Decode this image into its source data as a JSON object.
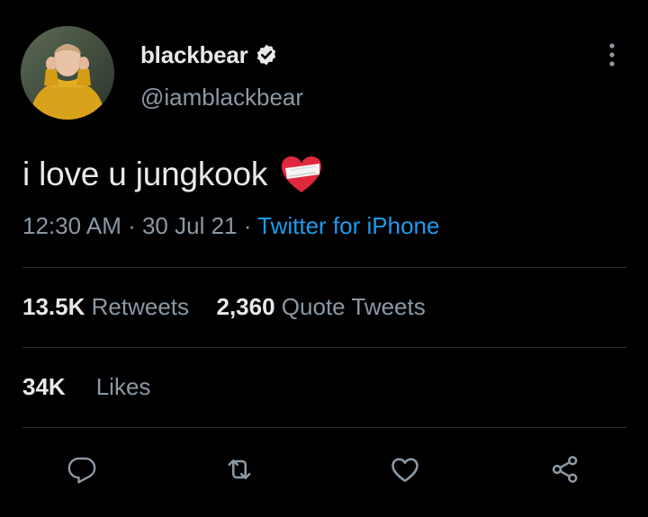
{
  "author": {
    "display_name": "blackbear",
    "handle": "@iamblackbear",
    "verified_icon": "verified-badge-icon",
    "avatar": "profile-photo"
  },
  "tweet": {
    "text": "i love u jungkook",
    "emoji": "bandaged-heart-emoji",
    "time": "12:30 AM",
    "separator": " · ",
    "date": "30 Jul 21",
    "source": "Twitter for iPhone"
  },
  "stats": {
    "retweets_count": "13.5K",
    "retweets_label": "Retweets",
    "quotes_count": "2,360",
    "quotes_label": "Quote Tweets",
    "likes_count": "34K",
    "likes_label": "Likes"
  },
  "actions": [
    "reply-icon",
    "retweet-icon",
    "like-icon",
    "share-icon"
  ],
  "colors": {
    "background": "#000000",
    "primary_text": "#e7e9ea",
    "secondary_text": "#8b98a5",
    "link": "#1d9bf0",
    "divider": "#2f3336"
  }
}
